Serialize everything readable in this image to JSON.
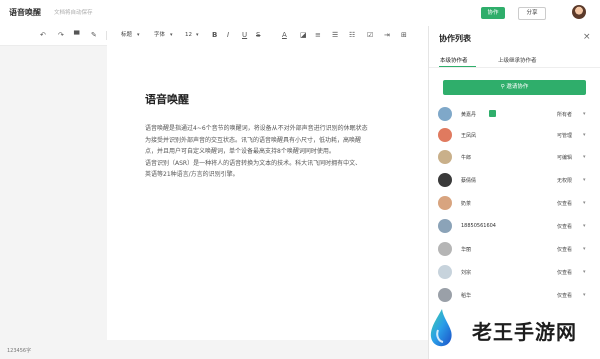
{
  "header": {
    "doc_title": "语音唤醒",
    "save_status": "文档将自动保存",
    "collab_button": "协作",
    "share_button": "分享"
  },
  "toolbar": {
    "heading": "标题",
    "font": "字体",
    "size": "12"
  },
  "document": {
    "title": "语音唤醒",
    "lines": [
      "语音唤醒是指通过4~6个音节的唤醒词，将设备从不对外部声音进行识别的休眠状态",
      "为接受并识别外部声音的交互状态。讯飞的语音唤醒具有小尺寸，低功耗，高唤醒",
      "点，并且用户可自定义唤醒词，单个设备最高支持8个唤醒词同时使用。",
      "语音识别（ASR）是一种将人的语音转换为文本的技术。科大讯飞同时拥有中文、",
      "英语等21种语言/方言的识别引擎。"
    ]
  },
  "status": {
    "word_count": "123456字"
  },
  "panel": {
    "title": "协作列表",
    "tabs": [
      "本级协作者",
      "上级继承协作者"
    ],
    "invite_button": "邀请协作",
    "collaborators": [
      {
        "name": "黄嘉丹",
        "permission": "所有者",
        "color": "#7fa8c9"
      },
      {
        "name": "王凤凤",
        "permission": "可管理",
        "color": "#e07a5f"
      },
      {
        "name": "牛郎",
        "permission": "可编辑",
        "color": "#c9b08a"
      },
      {
        "name": "蔡倩倩",
        "permission": "无权限",
        "color": "#3a3a3a"
      },
      {
        "name": "奶茶",
        "permission": "仅查看",
        "color": "#d8a47f"
      },
      {
        "name": "18850561604",
        "permission": "仅查看",
        "color": "#8ba3b8"
      },
      {
        "name": "华丽",
        "permission": "仅查看",
        "color": "#b5b5b5"
      },
      {
        "name": "刘宗",
        "permission": "仅查看",
        "color": "#c7d3dc"
      },
      {
        "name": "稻华",
        "permission": "仅查看",
        "color": "#9aa0a8"
      }
    ]
  },
  "watermark": {
    "site_name": "老王手游网"
  }
}
